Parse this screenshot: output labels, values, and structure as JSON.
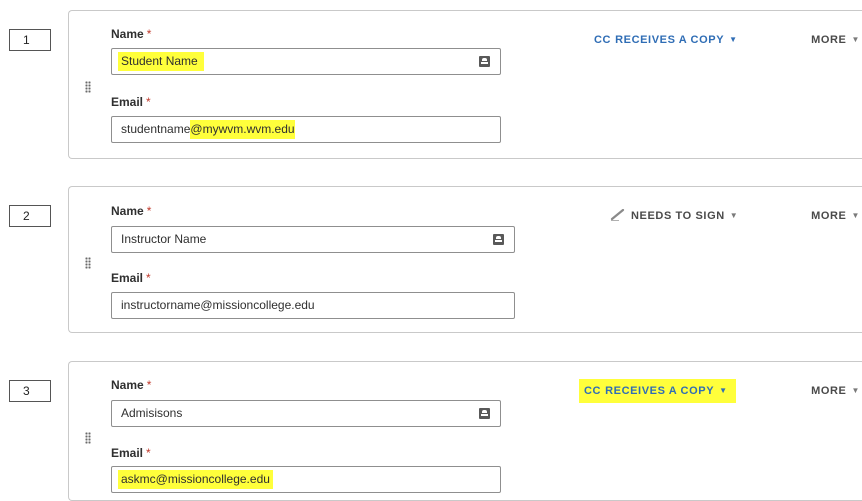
{
  "recipients": [
    {
      "order": "1",
      "name_label": "Name",
      "required_mark": "*",
      "name_value_prefix": "",
      "name_value_highlight": "Student Name",
      "email_label": "Email",
      "email_value_prefix": "studentname",
      "email_value_highlight": "@mywvm.wvm.edu",
      "role_icon": "CC",
      "role": "RECEIVES A COPY",
      "more": "MORE"
    },
    {
      "order": "2",
      "name_label": "Name",
      "required_mark": "*",
      "name_value": "Instructor Name",
      "email_label": "Email",
      "email_value": "instructorname@missioncollege.edu",
      "role_icon": "pen-icon",
      "role": "NEEDS TO SIGN",
      "more": "MORE"
    },
    {
      "order": "3",
      "name_label": "Name",
      "required_mark": "*",
      "name_value": "Admisisons",
      "email_label": "Email",
      "email_value_highlight": "askmc@missioncollege.edu",
      "role_icon": "CC",
      "role": "RECEIVES A COPY",
      "more": "MORE"
    }
  ],
  "colors": {
    "cc_blue": "#2f6db5",
    "highlight_yellow": "#ffff3b",
    "required_red": "#c0392b"
  }
}
